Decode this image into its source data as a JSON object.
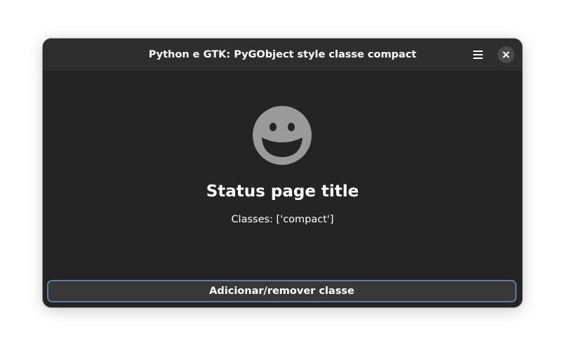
{
  "window": {
    "title": "Python e GTK: PyGObject style classe compact"
  },
  "headerbar": {
    "menu_icon": "hamburger-menu-icon",
    "close_icon": "close-icon"
  },
  "status_page": {
    "icon": "smiley-face-icon",
    "title": "Status page title",
    "description": "Classes: ['compact']"
  },
  "action_button": {
    "label": "Adicionar/remover classe"
  },
  "colors": {
    "window_bg": "#242424",
    "headerbar_bg": "#2e2e2e",
    "button_bg": "#383838",
    "focus_ring": "#5f7b9e",
    "icon_fill": "#9a9a9a",
    "text": "#ffffff"
  }
}
